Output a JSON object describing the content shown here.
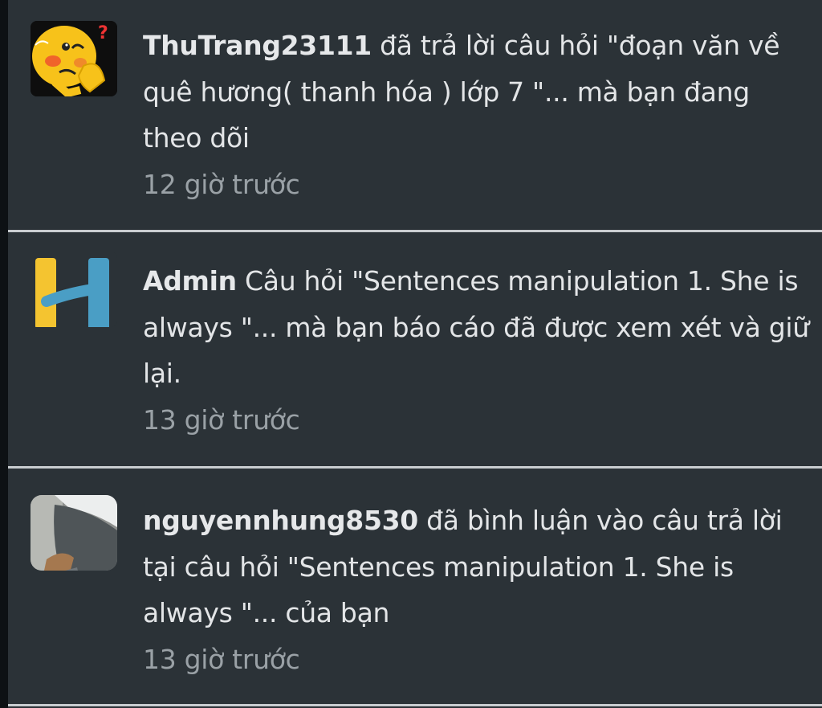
{
  "notifications": [
    {
      "username": "ThuTrang23111",
      "message": " đã trả lời câu hỏi \"đoạn văn về quê hương( thanh hóa ) lớp 7 \"... mà bạn đang theo dõi",
      "time": "12 giờ trước",
      "avatar": "emoji-face-icon"
    },
    {
      "username": "Admin",
      "message": " Câu hỏi \"Sentences manipulation 1. She is always  \"... mà bạn báo cáo đã được xem xét và giữ lại.",
      "time": "13 giờ trước",
      "avatar": "h-logo-icon"
    },
    {
      "username": "nguyennhung8530",
      "message": " đã bình luận vào câu trả lời tại câu hỏi \"Sentences manipulation 1. She is always  \"... của bạn",
      "time": "13 giờ trước",
      "avatar": "photo-avatar"
    }
  ],
  "colors": {
    "background": "#2b3237",
    "text": "#e3e5e7",
    "time": "#9aa1a6",
    "divider": "#c9cdd0",
    "logo_yellow": "#f4c430",
    "logo_blue": "#4a9ec5"
  }
}
